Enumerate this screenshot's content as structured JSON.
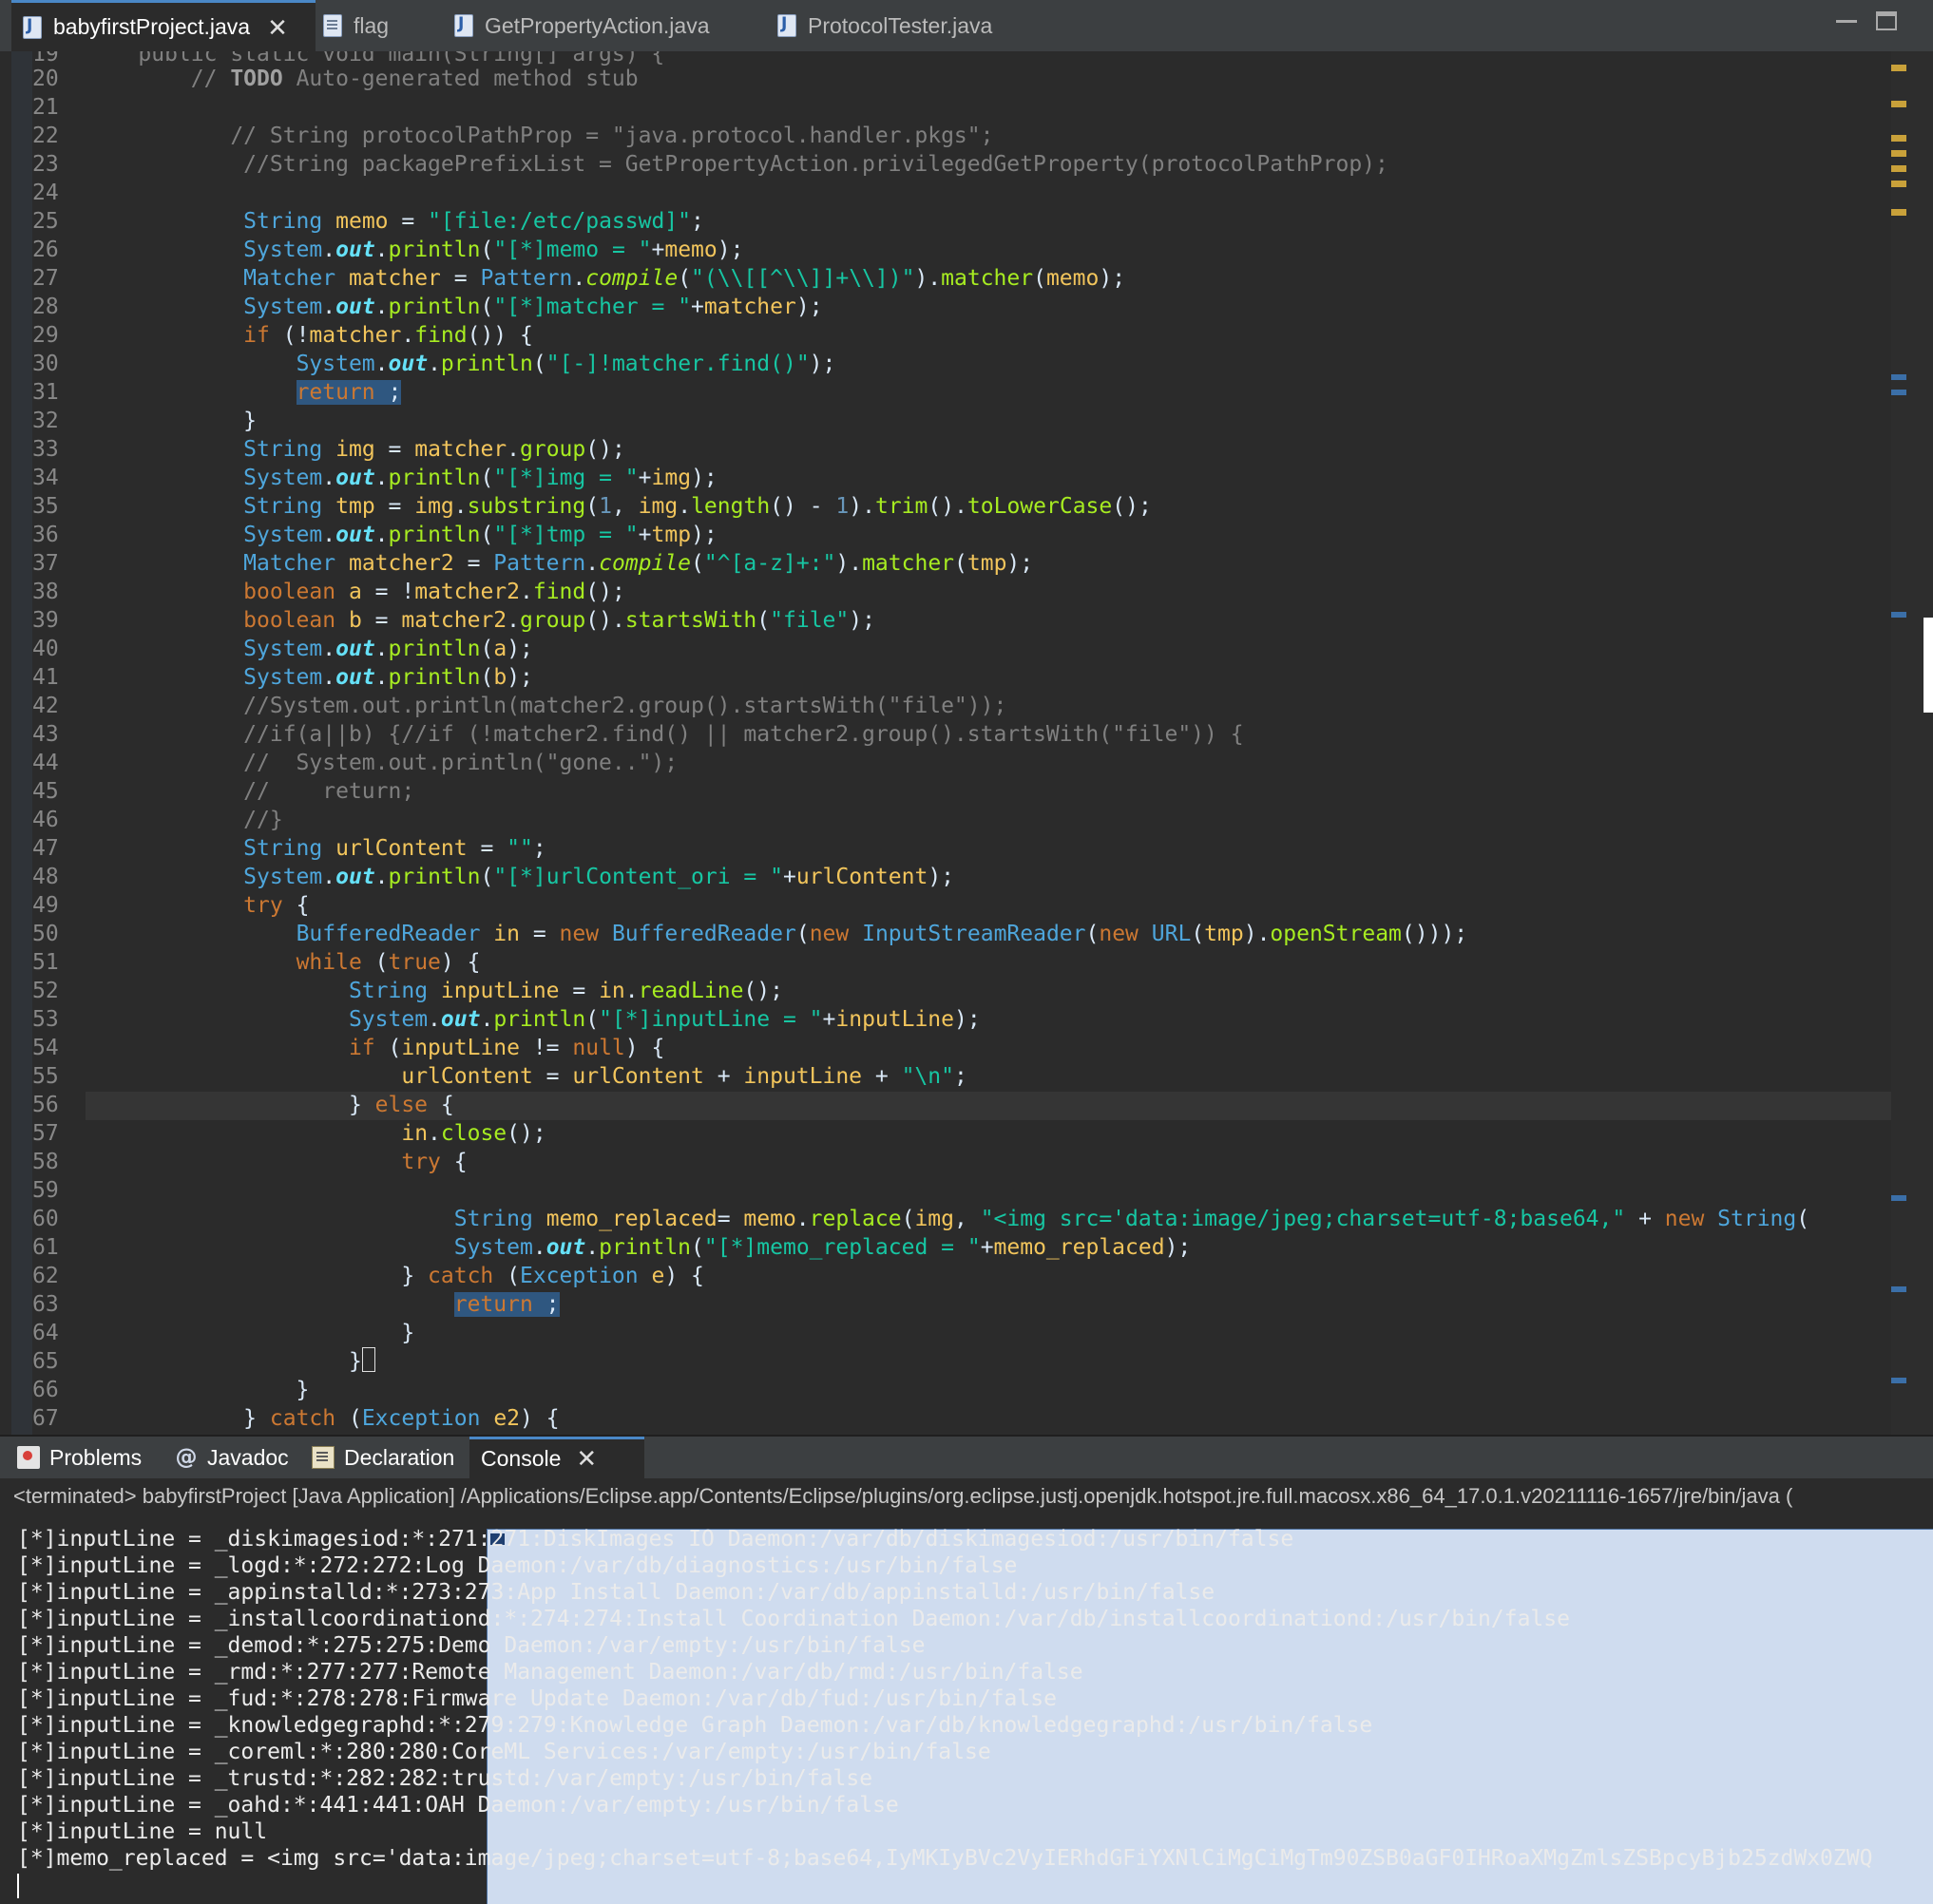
{
  "editor_tabs": [
    {
      "label": "babyfirstProject.java",
      "active": true,
      "icon": "java-file-icon"
    },
    {
      "label": "flag",
      "active": false,
      "icon": "text-file-icon"
    },
    {
      "label": "GetPropertyAction.java",
      "active": false,
      "icon": "java-file-icon"
    },
    {
      "label": "ProtocolTester.java",
      "active": false,
      "icon": "java-file-icon"
    }
  ],
  "code": {
    "line_numbers": [
      "19",
      "20",
      "21",
      "22",
      "23",
      "24",
      "25",
      "26",
      "27",
      "28",
      "29",
      "30",
      "31",
      "32",
      "33",
      "34",
      "35",
      "36",
      "37",
      "38",
      "39",
      "40",
      "41",
      "42",
      "43",
      "44",
      "45",
      "46",
      "47",
      "48",
      "49",
      "50",
      "51",
      "52",
      "53",
      "54",
      "55",
      "56",
      "57",
      "58",
      "59",
      "60",
      "61",
      "62",
      "63",
      "64",
      "65",
      "66",
      "67"
    ],
    "partial_top_line": "    public static void main(String[] args) {",
    "lines": [
      "        // TODO Auto-generated method stub",
      "",
      "           // String protocolPathProp = \"java.protocol.handler.pkgs\";",
      "            //String packagePrefixList = GetPropertyAction.privilegedGetProperty(protocolPathProp);",
      "",
      "            String memo = \"[file:/etc/passwd]\";",
      "            System.out.println(\"[*]memo = \"+memo);",
      "            Matcher matcher = Pattern.compile(\"(\\\\[[^\\\\]]+\\\\])\").matcher(memo);",
      "            System.out.println(\"[*]matcher = \"+matcher);",
      "            if (!matcher.find()) {",
      "                System.out.println(\"[-]!matcher.find()\");",
      "                return ;",
      "            }",
      "            String img = matcher.group();",
      "            System.out.println(\"[*]img = \"+img);",
      "            String tmp = img.substring(1, img.length() - 1).trim().toLowerCase();",
      "            System.out.println(\"[*]tmp = \"+tmp);",
      "            Matcher matcher2 = Pattern.compile(\"^[a-z]+:\").matcher(tmp);",
      "            boolean a = !matcher2.find();",
      "            boolean b = matcher2.group().startsWith(\"file\");",
      "            System.out.println(a);",
      "            System.out.println(b);",
      "            //System.out.println(matcher2.group().startsWith(\"file\"));",
      "            //if(a||b) {//if (!matcher2.find() || matcher2.group().startsWith(\"file\")) {",
      "            //  System.out.println(\"gone..\");",
      "            //    return;",
      "            //}",
      "            String urlContent = \"\";",
      "            System.out.println(\"[*]urlContent_ori = \"+urlContent);",
      "            try {",
      "                BufferedReader in = new BufferedReader(new InputStreamReader(new URL(tmp).openStream()));",
      "                while (true) {",
      "                    String inputLine = in.readLine();",
      "                    System.out.println(\"[*]inputLine = \"+inputLine);",
      "                    if (inputLine != null) {",
      "                        urlContent = urlContent + inputLine + \"\\n\";",
      "                    } else {",
      "                        in.close();",
      "                        try {",
      "",
      "                            String memo_replaced= memo.replace(img, \"<img src='data:image/jpeg;charset=utf-8;base64,\" + new String(",
      "                            System.out.println(\"[*]memo_replaced = \"+memo_replaced);",
      "                        } catch (Exception e) {",
      "                            return ;",
      "                        }",
      "                    }",
      "                }",
      "            } catch (Exception e2) {"
    ]
  },
  "bottom_tabs": [
    {
      "label": "Problems",
      "icon": "problems-icon"
    },
    {
      "label": "Javadoc",
      "icon": "javadoc-icon"
    },
    {
      "label": "Declaration",
      "icon": "declaration-icon"
    },
    {
      "label": "Console",
      "icon": "console-icon",
      "active": true
    }
  ],
  "console": {
    "terminated_line": "<terminated> babyfirstProject [Java Application] /Applications/Eclipse.app/Contents/Eclipse/plugins/org.eclipse.justj.openjdk.hotspot.jre.full.macosx.x86_64_17.0.1.v20211116-1657/jre/bin/java  (",
    "lines": [
      "[*]inputLine = _diskimagesiod:*:271:271:DiskImages IO Daemon:/var/db/diskimagesiod:/usr/bin/false",
      "[*]inputLine = _logd:*:272:272:Log Daemon:/var/db/diagnostics:/usr/bin/false",
      "[*]inputLine = _appinstalld:*:273:273:App Install Daemon:/var/db/appinstalld:/usr/bin/false",
      "[*]inputLine = _installcoordinationd:*:274:274:Install Coordination Daemon:/var/db/installcoordinationd:/usr/bin/false",
      "[*]inputLine = _demod:*:275:275:Demo Daemon:/var/empty:/usr/bin/false",
      "[*]inputLine = _rmd:*:277:277:Remote Management Daemon:/var/db/rmd:/usr/bin/false",
      "[*]inputLine = _fud:*:278:278:Firmware Update Daemon:/var/db/fud:/usr/bin/false",
      "[*]inputLine = _knowledgegraphd:*:279:279:Knowledge Graph Daemon:/var/db/knowledgegraphd:/usr/bin/false",
      "[*]inputLine = _coreml:*:280:280:CoreML Services:/var/empty:/usr/bin/false",
      "[*]inputLine = _trustd:*:282:282:trustd:/var/empty:/usr/bin/false",
      "[*]inputLine = _oahd:*:441:441:OAH Daemon:/var/empty:/usr/bin/false",
      "[*]inputLine = null",
      "[*]memo_replaced = <img src='data:image/jpeg;charset=utf-8;base64,IyMKIyBVc2VyIERhdGFiYXNlCiMgCiMgTm90ZSB0aGF0IHRoaXMgZmlsZSBpcyBjb25zdWx0ZWQ"
    ]
  },
  "colors": {
    "editor_background": "#2b2b2b",
    "keyword": "#cc7832",
    "type": "#4ea6dc",
    "variable": "#f2c55c",
    "string": "#17c6a3",
    "comment": "#808080",
    "method": "#a7ec21",
    "field": "#66e1f8",
    "selection": "#2f5780"
  }
}
